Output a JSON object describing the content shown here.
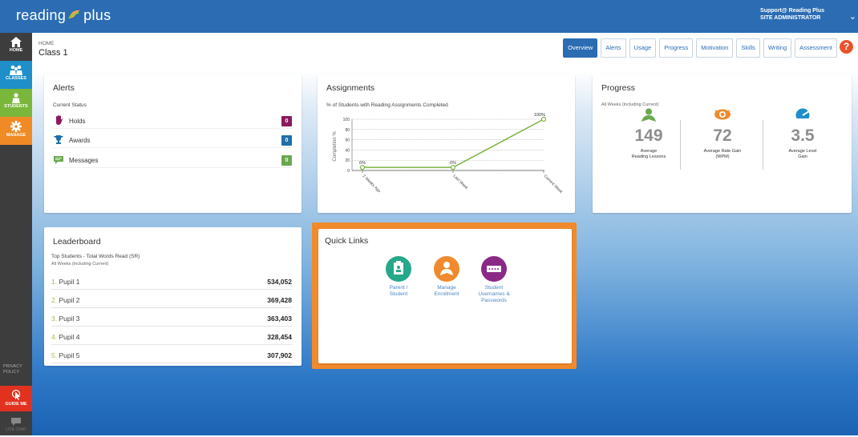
{
  "app": {
    "logo_text_left": "reading",
    "logo_text_right": "plus",
    "user_name": "Support@ Reading Plus",
    "user_role": "SITE ADMINISTRATOR"
  },
  "sidebar": {
    "items": [
      {
        "label": "HOME",
        "icon": "home-icon"
      },
      {
        "label": "CLASSES",
        "icon": "classes-icon"
      },
      {
        "label": "STUDENTS",
        "icon": "students-icon"
      },
      {
        "label": "MANAGE",
        "icon": "gear-icon"
      }
    ],
    "privacy_line1": "PRIVACY",
    "privacy_line2": "POLICY",
    "guide_label": "GUIDE ME",
    "chat_label": "LIVE CHAT"
  },
  "header": {
    "breadcrumb": "HOME",
    "title": "Class 1",
    "help_label": "?"
  },
  "tabs": [
    {
      "label": "Overview",
      "active": true
    },
    {
      "label": "Alerts",
      "active": false
    },
    {
      "label": "Usage",
      "active": false
    },
    {
      "label": "Progress",
      "active": false
    },
    {
      "label": "Motivation",
      "active": false
    },
    {
      "label": "Skills",
      "active": false
    },
    {
      "label": "Writing",
      "active": false
    },
    {
      "label": "Assessment",
      "active": false
    }
  ],
  "alerts": {
    "title": "Alerts",
    "subtitle": "Current Status",
    "rows": [
      {
        "label": "Holds",
        "count": "0",
        "color": "#8a1a5d"
      },
      {
        "label": "Awards",
        "count": "0",
        "color": "#1f6fa8"
      },
      {
        "label": "Messages",
        "count": "0",
        "color": "#6aa84f"
      }
    ]
  },
  "assignments": {
    "title": "Assignments",
    "subtitle": "% of Students with Reading Assignments Completed",
    "ylabel": "Completion %"
  },
  "chart_data": {
    "type": "line",
    "categories": [
      "2 Weeks Ago",
      "Last Week",
      "Current Week"
    ],
    "values": [
      6,
      6,
      100
    ],
    "data_labels": [
      "6%",
      "6%",
      "100%"
    ],
    "yticks": [
      0,
      20,
      40,
      60,
      80,
      100
    ],
    "ylim": [
      0,
      100
    ],
    "ylabel": "Completion %",
    "grid": true,
    "color": "#7cb342"
  },
  "progress": {
    "title": "Progress",
    "subtitle": "All Weeks (Including Current)",
    "stats": [
      {
        "value": "149",
        "label1": "Average",
        "label2": "Reading Lessons",
        "icon": "reader-icon",
        "color": "#6aa84f"
      },
      {
        "value": "72",
        "label1": "Average Rate Gain",
        "label2": "(WPM)",
        "icon": "eye-icon",
        "color": "#f08a2c"
      },
      {
        "value": "3.5",
        "label1": "Average Level",
        "label2": "Gain",
        "icon": "gauge-icon",
        "color": "#1f8fc9"
      }
    ]
  },
  "leaderboard": {
    "title": "Leaderboard",
    "subtitle": "Top Students - Total Words Read (SR)",
    "subtitle2": "All Weeks (Including Current)",
    "rows": [
      {
        "rank": "1.",
        "name": "Pupil 1",
        "value": "534,052"
      },
      {
        "rank": "2.",
        "name": "Pupil 2",
        "value": "369,428"
      },
      {
        "rank": "3.",
        "name": "Pupil 3",
        "value": "363,403"
      },
      {
        "rank": "4.",
        "name": "Pupil 4",
        "value": "328,454"
      },
      {
        "rank": "5.",
        "name": "Pupil 5",
        "value": "307,902"
      }
    ]
  },
  "quick_links": {
    "title": "Quick Links",
    "links": [
      {
        "line1": "Parent /",
        "line2": "Student",
        "line3": "",
        "icon": "parent-student-icon",
        "color": "#26a88a"
      },
      {
        "line1": "Manage",
        "line2": "Enrollment",
        "line3": "",
        "icon": "enrollment-icon",
        "color": "#f08a2c"
      },
      {
        "line1": "Student",
        "line2": "Usernames &",
        "line3": "Passwords",
        "icon": "password-icon",
        "color": "#8a2a86"
      }
    ]
  }
}
